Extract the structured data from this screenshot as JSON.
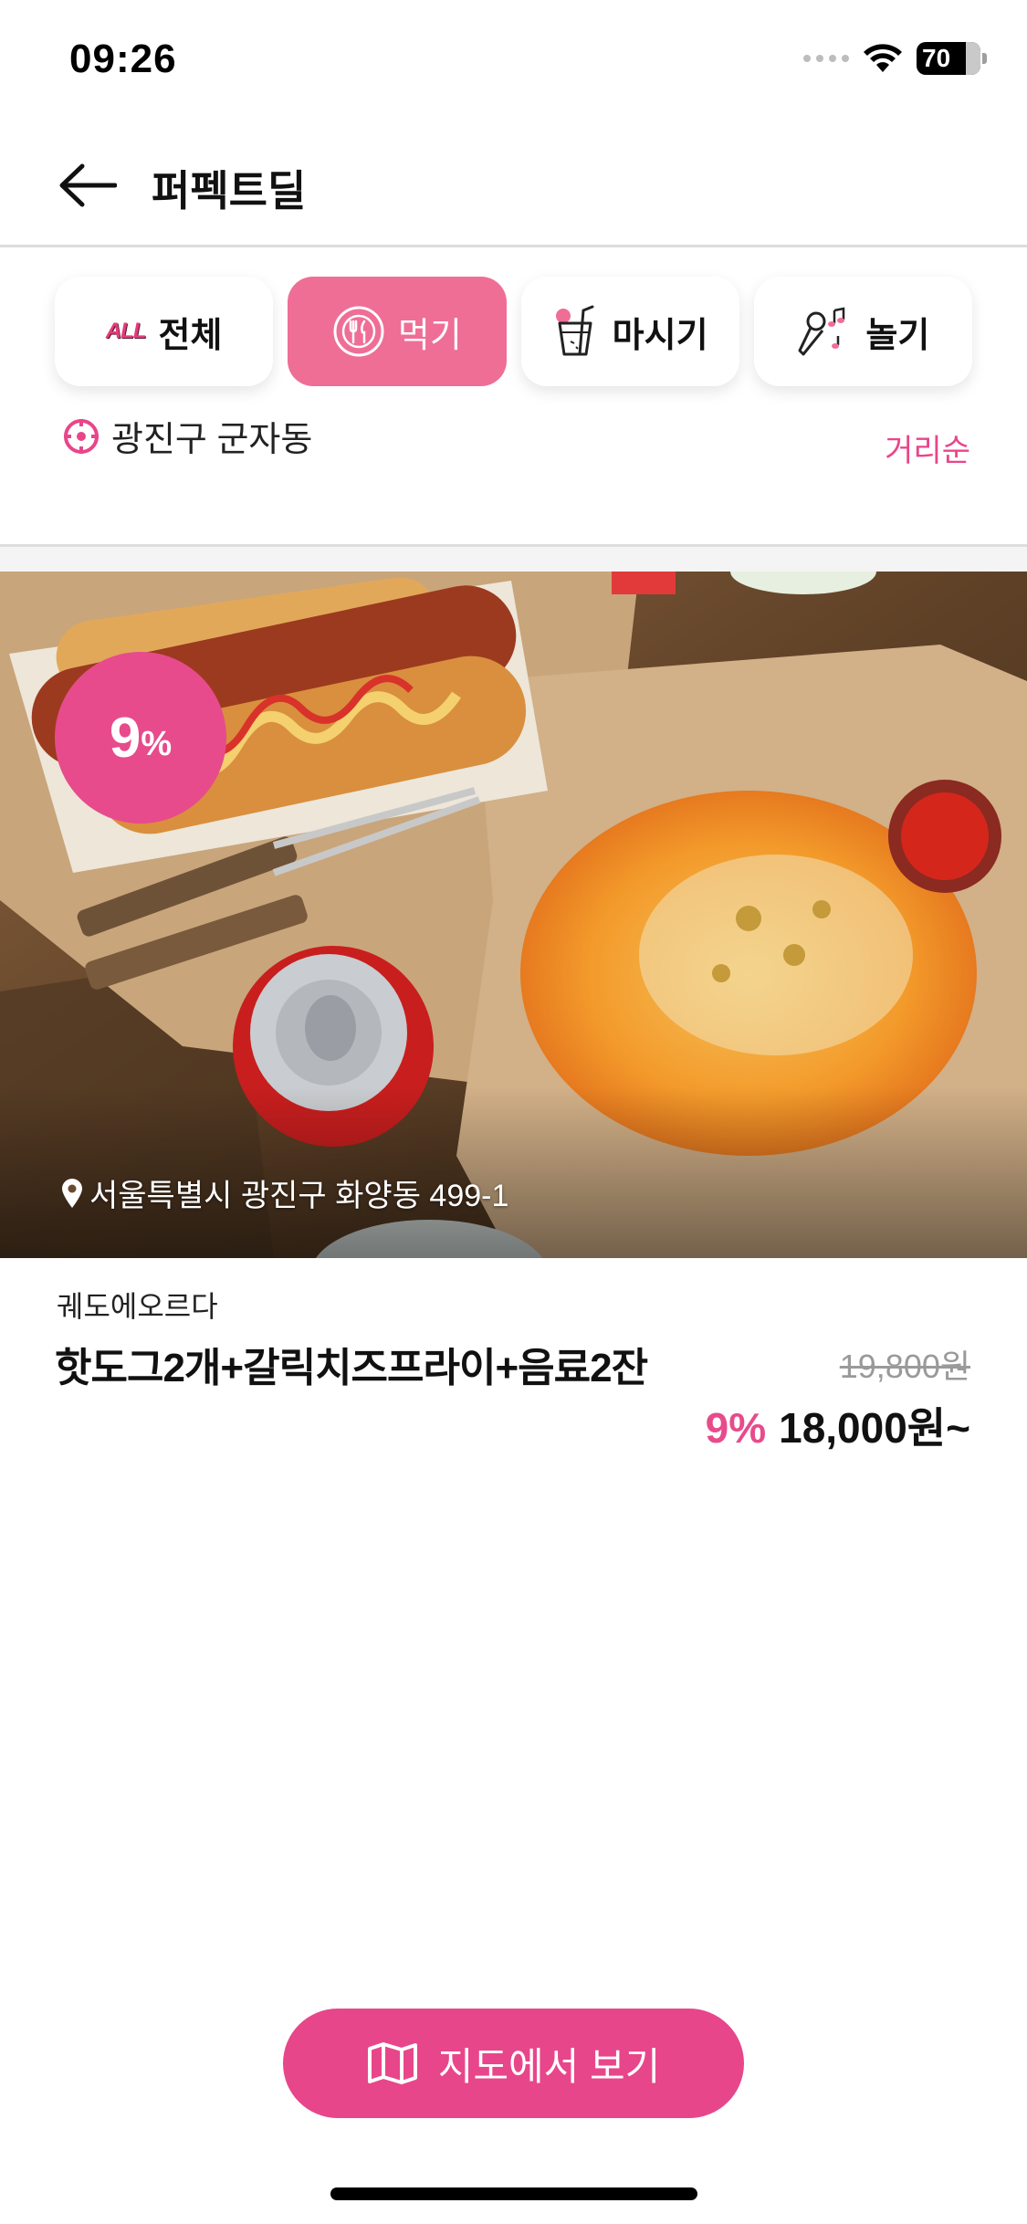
{
  "status_bar": {
    "time": "09:26",
    "battery": "70"
  },
  "header": {
    "title": "퍼펙트딜"
  },
  "tabs": [
    {
      "label": "전체",
      "icon": "all-icon",
      "icon_text": "ALL",
      "active": false
    },
    {
      "label": "먹기",
      "icon": "plate-cutlery-icon",
      "active": true
    },
    {
      "label": "마시기",
      "icon": "drink-cup-icon",
      "active": false
    },
    {
      "label": "놀기",
      "icon": "microphone-icon",
      "active": false
    }
  ],
  "location": {
    "text": "광진구 군자동",
    "icon": "location-target-icon"
  },
  "sort": {
    "label": "거리순"
  },
  "deal": {
    "discount_number": "9",
    "discount_symbol": "%",
    "address": "서울특별시 광진구 화양동 499-1",
    "store_name": "궤도에오르다",
    "title": "핫도그2개+갈릭치즈프라이+음료2잔",
    "original_price": "19,800원",
    "discount_rate": "9%",
    "price": "18,000원~"
  },
  "map_button": {
    "label": "지도에서 보기",
    "icon": "map-icon"
  },
  "colors": {
    "accent": "#e8468a",
    "tab_active": "#ef6e96"
  }
}
